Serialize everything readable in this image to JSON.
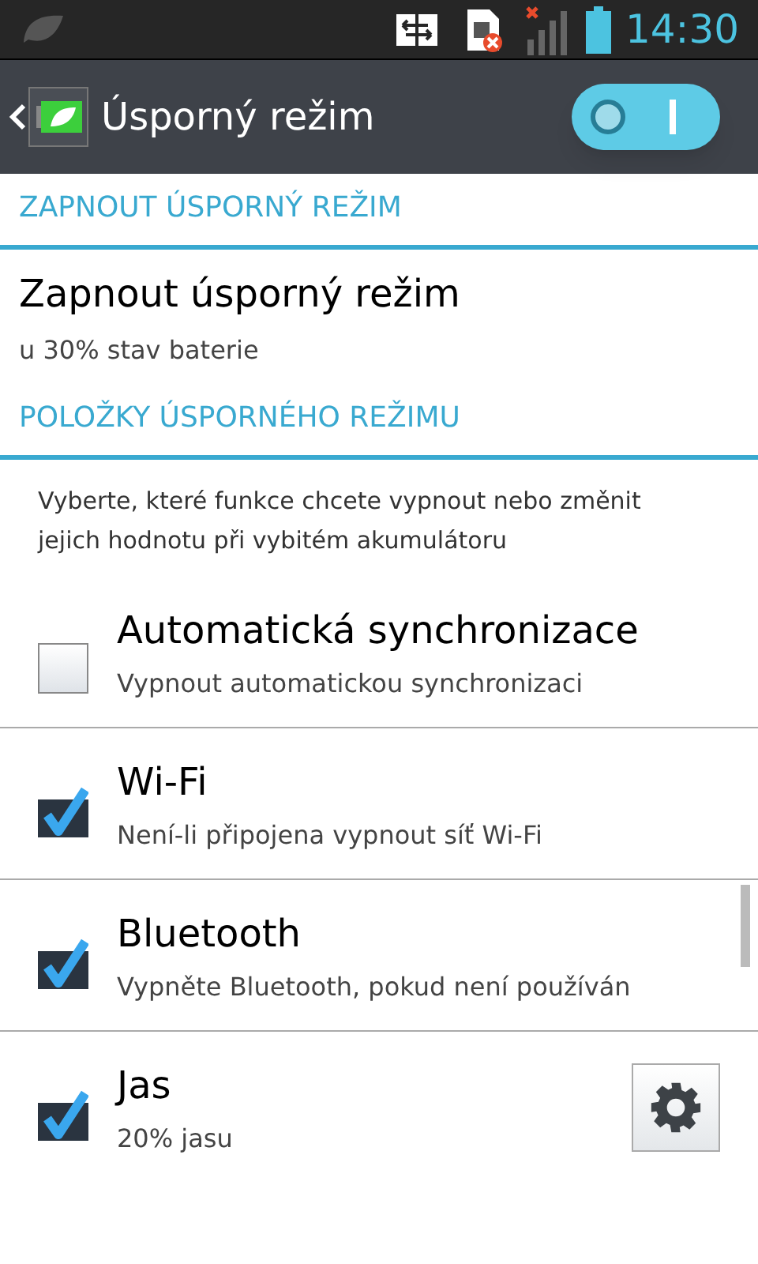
{
  "status_bar": {
    "time": "14:30"
  },
  "header": {
    "title": "Úsporný režim",
    "switch_on": true
  },
  "sections": [
    {
      "title": "ZAPNOUT ÚSPORNÝ REŽIM",
      "entries": [
        {
          "kind": "text",
          "title": "Zapnout úsporný režim",
          "subtitle": "u 30% stav baterie"
        }
      ]
    },
    {
      "title": "POLOŽKY ÚSPORNÉHO REŽIMU",
      "description": "Vyberte, které funkce chcete vypnout nebo změnit jejich hodnotu při vybitém akumulátoru",
      "entries": [
        {
          "kind": "checkbox",
          "title": "Automatická synchronizace",
          "subtitle": "Vypnout automatickou synchronizaci",
          "checked": false,
          "settings_button": false
        },
        {
          "kind": "checkbox",
          "title": "Wi-Fi",
          "subtitle": "Není-li připojena vypnout síť Wi-Fi",
          "checked": true,
          "settings_button": false
        },
        {
          "kind": "checkbox",
          "title": "Bluetooth",
          "subtitle": "Vypněte Bluetooth, pokud není používán",
          "checked": true,
          "settings_button": false
        },
        {
          "kind": "checkbox",
          "title": "Jas",
          "subtitle": "20% jasu",
          "checked": true,
          "settings_button": true
        }
      ]
    }
  ]
}
